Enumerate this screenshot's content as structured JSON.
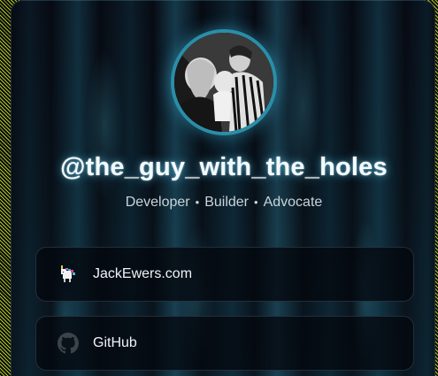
{
  "profile": {
    "handle": "@the_guy_with_the_holes",
    "tagline": [
      "Developer",
      "Builder",
      "Advocate"
    ],
    "separator": "•"
  },
  "links": [
    {
      "label": "JackEwers.com",
      "icon": "unicorn-logo-icon"
    },
    {
      "label": "GitHub",
      "icon": "github-icon"
    }
  ],
  "colors": {
    "accent": "#2a8ea8",
    "glow": "#5ac8f0",
    "card_background": "#070a12",
    "page_pattern": "#d2e628"
  }
}
